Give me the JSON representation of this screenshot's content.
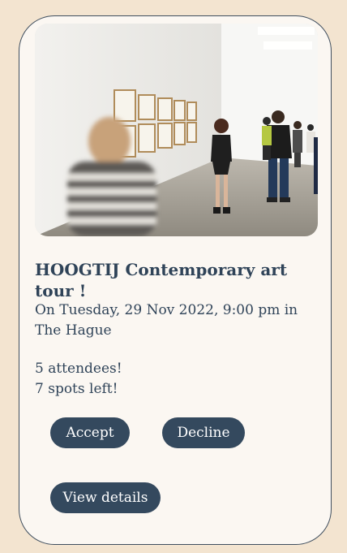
{
  "event": {
    "image_alt": "Visitors in a white-walled contemporary art gallery looking at framed works",
    "title": "HOOGTIJ Contemporary art tour !",
    "when": "On Tuesday, 29 Nov 2022, 9:00 pm in The Hague",
    "attendees": "5 attendees!",
    "spots_left": "7 spots left!"
  },
  "actions": {
    "accept_label": "Accept",
    "decline_label": "Decline",
    "details_label": "View details"
  },
  "colors": {
    "page_bg": "#f3e4d0",
    "card_bg": "#fbf7f2",
    "button_bg": "#34495e",
    "text": "#2f4358"
  }
}
